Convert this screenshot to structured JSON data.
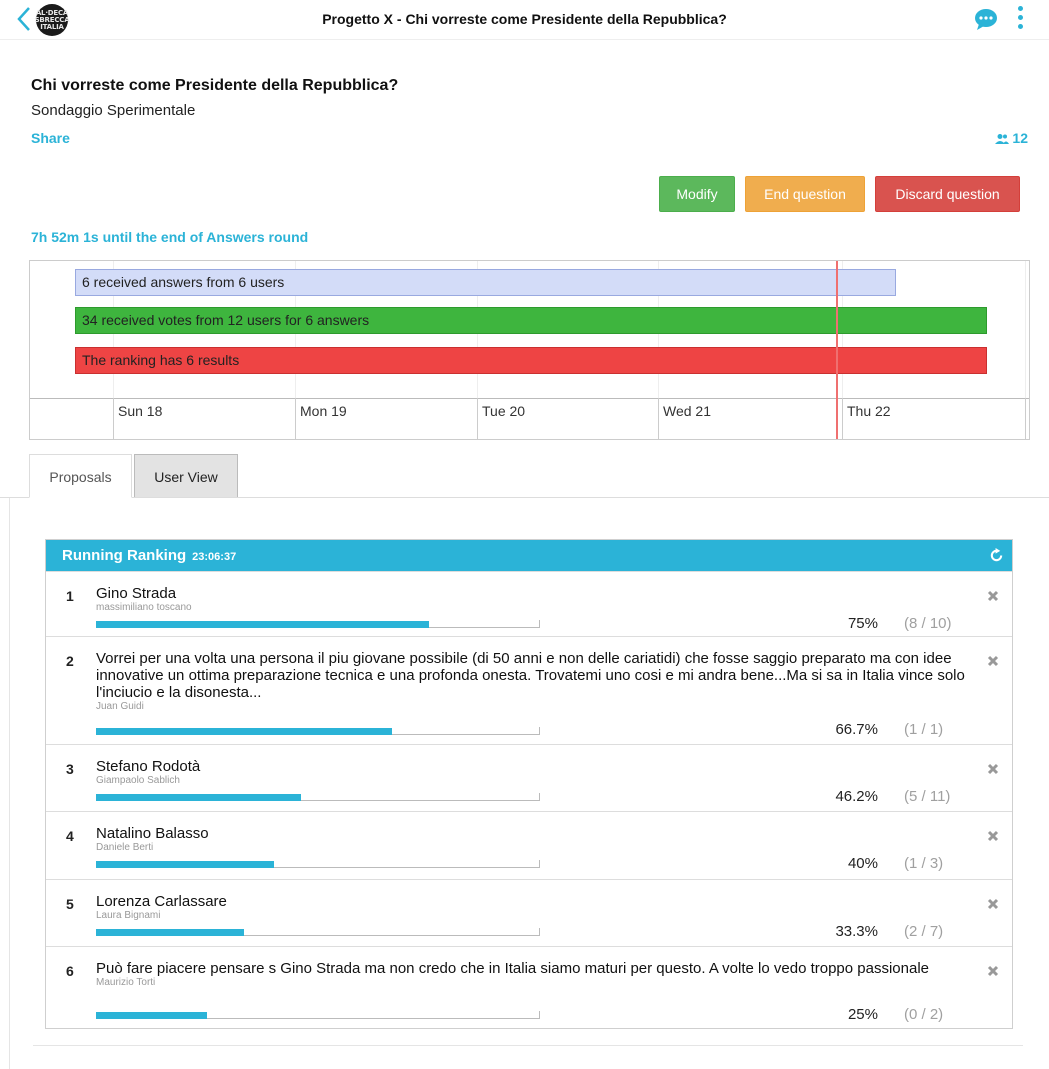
{
  "header": {
    "title": "Progetto X - Chi vorreste come Presidente della Repubblica?",
    "logo_text": "ALDECA SBRECCA ITALIA"
  },
  "question": {
    "title": "Chi vorreste come Presidente della Repubblica?",
    "subtitle": "Sondaggio Sperimentale",
    "share_label": "Share",
    "users_count": "12"
  },
  "actions": {
    "modify_label": "Modify",
    "end_label": "End question",
    "discard_label": "Discard question"
  },
  "timer": "7h 52m 1s until the end of Answers round",
  "timeline": {
    "bars": [
      {
        "label": "6 received answers from 6 users",
        "color": "#d3dcf8",
        "border": "#99a9e0"
      },
      {
        "label": "34 received votes from 12 users for 6 answers",
        "color": "#3eb53e",
        "border": "#2d9a2d"
      },
      {
        "label": "The ranking has 6 results",
        "color": "#ee4444",
        "border": "#c93030"
      }
    ],
    "days": [
      "Sun 18",
      "Mon 19",
      "Tue 20",
      "Wed 21",
      "Thu 22"
    ],
    "now_color": "#ef7070"
  },
  "tabs": [
    {
      "label": "Proposals",
      "active": true
    },
    {
      "label": "User View",
      "active": false
    }
  ],
  "ranking": {
    "title": "Running Ranking",
    "time": "23:06:37",
    "items": [
      {
        "rank": "1",
        "text": "Gino Strada",
        "author": "massimiliano toscano",
        "pct": "75%",
        "frac": "(8 / 10)",
        "value": 0.75
      },
      {
        "rank": "2",
        "text": "Vorrei per una volta una persona il piu giovane possibile (di 50 anni e non delle cariatidi) che fosse saggio preparato ma con idee innovative un ottima preparazione tecnica e una profonda onesta. Trovatemi uno cosi e mi andra bene...Ma si sa in Italia vince solo l'inciucio e la disonesta...",
        "author": "Juan Guidi",
        "pct": "66.7%",
        "frac": "(1 / 1)",
        "value": 0.667
      },
      {
        "rank": "3",
        "text": "Stefano Rodotà",
        "author": "Giampaolo Sablich",
        "pct": "46.2%",
        "frac": "(5 / 11)",
        "value": 0.462
      },
      {
        "rank": "4",
        "text": "Natalino Balasso",
        "author": "Daniele Berti",
        "pct": "40%",
        "frac": "(1 / 3)",
        "value": 0.4
      },
      {
        "rank": "5",
        "text": "Lorenza Carlassare",
        "author": "Laura Bignami",
        "pct": "33.3%",
        "frac": "(2 / 7)",
        "value": 0.333
      },
      {
        "rank": "6",
        "text": "Può fare piacere pensare s Gino Strada ma non credo che in Italia siamo maturi per questo. A volte lo vedo troppo passionale",
        "author": "Maurizio Torti",
        "pct": "25%",
        "frac": "(0 / 2)",
        "value": 0.25
      }
    ]
  },
  "colors": {
    "accent": "#2bb3d7",
    "modify": "#5cb85c",
    "end": "#f0ad4e",
    "discard": "#d9534f"
  }
}
